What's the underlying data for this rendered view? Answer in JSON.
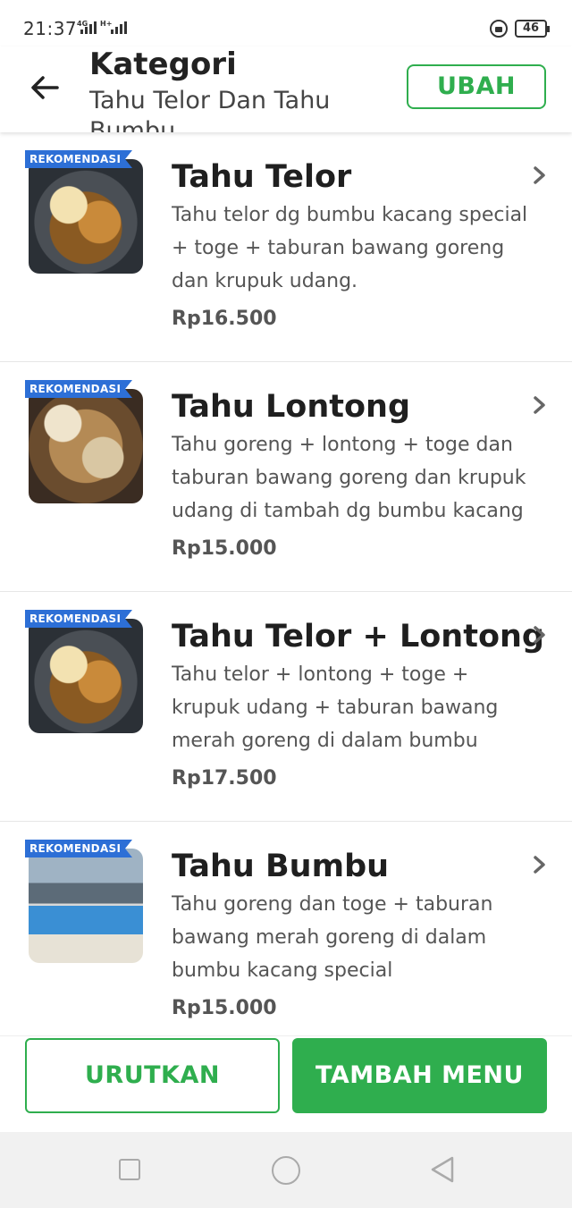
{
  "status_bar": {
    "time": "21:37",
    "network_1": "4G",
    "network_2": "H+",
    "battery": "46",
    "icons": [
      "signal-icon",
      "lock-icon",
      "battery-icon"
    ]
  },
  "header": {
    "title": "Kategori",
    "subtitle": "Tahu Telor Dan Tahu Bumbu",
    "edit_label": "UBAH",
    "back_icon": "arrow-left-icon"
  },
  "items": [
    {
      "badge": "REKOMENDASI",
      "name": "Tahu Telor",
      "description": "Tahu telor dg bumbu kacang special + toge + taburan bawang goreng dan krupuk udang.",
      "price": "Rp16.500"
    },
    {
      "badge": "REKOMENDASI",
      "name": "Tahu Lontong",
      "description": "Tahu goreng + lontong + toge dan taburan bawang goreng dan krupuk udang di tambah dg bumbu kacang s...",
      "price": "Rp15.000"
    },
    {
      "badge": "REKOMENDASI",
      "name": "Tahu Telor + Lontong",
      "description": "Tahu telor + lontong + toge + krupuk udang + taburan bawang merah goreng di dalam bumbu kacang speci...",
      "price": "Rp17.500"
    },
    {
      "badge": "REKOMENDASI",
      "name": "Tahu Bumbu",
      "description": "Tahu goreng dan toge + taburan bawang merah goreng di dalam bumbu kacang special",
      "price": "Rp15.000"
    }
  ],
  "actions": {
    "sort_label": "URUTKAN",
    "add_menu_label": "TAMBAH MENU"
  },
  "colors": {
    "accent": "#2fae4e",
    "badge": "#2d6fd6",
    "text_dark": "#1f1f1f",
    "text_muted": "#555555"
  }
}
